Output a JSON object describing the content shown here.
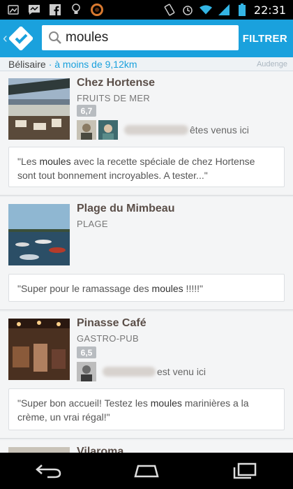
{
  "status_bar": {
    "time": "22:31",
    "left_icons": [
      "screenshot-icon",
      "chat-icon",
      "facebook-icon",
      "bulb-icon",
      "record-icon"
    ],
    "right_icons": [
      "vibrate-icon",
      "alarm-icon",
      "wifi-icon",
      "signal-icon",
      "battery-icon"
    ]
  },
  "action_bar": {
    "search_value": "moules",
    "filter_label": "FILTRER"
  },
  "location": {
    "city": "Bélisaire",
    "distance": "· à moins de 9,12km",
    "map_label": "Audenge"
  },
  "venues": [
    {
      "name": "Chez Hortense",
      "category": "FRUITS DE MER",
      "score": "6,7",
      "friends_text": "êtes venus ici",
      "tip_parts": [
        "\"Les ",
        "moules",
        " avec la recette spéciale de chez Hortense sont tout bonnement incroyables. A tester...\""
      ]
    },
    {
      "name": "Plage du Mimbeau",
      "category": "PLAGE",
      "tip_parts": [
        "\"Super pour le ramassage des ",
        "moules",
        " !!!!!\""
      ]
    },
    {
      "name": "Pinasse  Café",
      "category": "GASTRO-PUB",
      "score": "6,5",
      "friends_text": "est venu ici",
      "tip_parts": [
        "\"Super bon accueil! Testez les ",
        "moules",
        " marinières a la crème, un vrai régal!\""
      ]
    },
    {
      "name": "Vilaroma"
    }
  ],
  "colors": {
    "accent": "#1aa1dd",
    "venue_name": "#5a4e48",
    "score_badge": "#b8bcc0"
  }
}
